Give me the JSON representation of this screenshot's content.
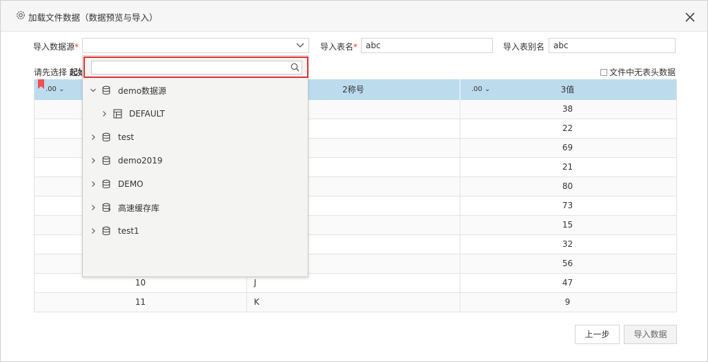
{
  "dialog": {
    "title": "加载文件数据（数据预览与导入）",
    "icons": {
      "title": "gear-icon",
      "close": "close-icon"
    }
  },
  "form": {
    "datasource_label": "导入数据源",
    "datasource_value": "",
    "table_name_label": "导入表名",
    "table_name_value": "abc",
    "table_alias_label": "导入表别名",
    "table_alias_value": "abc",
    "required_mark": "*",
    "hint_prefix": "请先选择",
    "hint_bold": "起始",
    "no_header_label": "文件中无表头数据"
  },
  "dropdown": {
    "search_placeholder": "",
    "items": [
      {
        "label": "demo数据源",
        "icon": "database-icon",
        "expanded": true
      },
      {
        "label": "DEFAULT",
        "icon": "schema-icon",
        "expanded": false
      },
      {
        "label": "test",
        "icon": "database-icon",
        "expanded": false
      },
      {
        "label": "demo2019",
        "icon": "database-icon",
        "expanded": false
      },
      {
        "label": "DEMO",
        "icon": "database-icon",
        "expanded": false
      },
      {
        "label": "高速缓存库",
        "icon": "cache-database-icon",
        "expanded": false
      },
      {
        "label": "test1",
        "icon": "database-icon",
        "expanded": false
      }
    ]
  },
  "table": {
    "headers": [
      {
        "format": ".00 ⌄",
        "name": ""
      },
      {
        "format": "",
        "name": "2称号"
      },
      {
        "format": ".00 ⌄",
        "name": "3值"
      }
    ],
    "rows": [
      {
        "c1": "",
        "c2": "",
        "c3": "38"
      },
      {
        "c1": "",
        "c2": "",
        "c3": "22"
      },
      {
        "c1": "",
        "c2": "",
        "c3": "69"
      },
      {
        "c1": "",
        "c2": "",
        "c3": "21"
      },
      {
        "c1": "",
        "c2": "",
        "c3": "80"
      },
      {
        "c1": "",
        "c2": "",
        "c3": "73"
      },
      {
        "c1": "",
        "c2": "",
        "c3": "15"
      },
      {
        "c1": "",
        "c2": "",
        "c3": "32"
      },
      {
        "c1": "",
        "c2": "",
        "c3": "56"
      },
      {
        "c1": "10",
        "c2": "J",
        "c3": "47"
      },
      {
        "c1": "11",
        "c2": "K",
        "c3": "9"
      }
    ]
  },
  "buttons": {
    "prev": "上一步",
    "import": "导入数据"
  },
  "colors": {
    "header_bg": "#bcdcee",
    "required": "#e0392d",
    "highlight_border": "#dd3333",
    "bookmark": "#f05050"
  }
}
